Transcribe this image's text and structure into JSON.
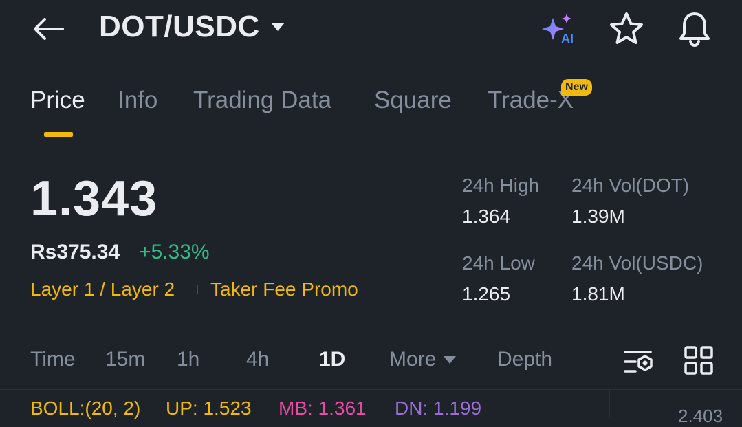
{
  "header": {
    "back_icon": "arrow-left-icon",
    "pair": "DOT/USDC",
    "ai_label": "AI",
    "colors": {
      "ai_gradient_start": "#4c8bf5",
      "ai_gradient_end": "#c87bff"
    }
  },
  "tabs": [
    {
      "label": "Price",
      "active": true
    },
    {
      "label": "Info"
    },
    {
      "label": "Trading Data"
    },
    {
      "label": "Square"
    },
    {
      "label": "Trade-X",
      "badge": "New"
    }
  ],
  "price": {
    "last": "1.343",
    "fiat": "Rs375.34",
    "change": "+5.33%",
    "tags": [
      "Layer 1 / Layer 2",
      "Taker Fee Promo"
    ]
  },
  "stats": {
    "high_label": "24h High",
    "high_value": "1.364",
    "vol_base_label": "24h Vol(DOT)",
    "vol_base_value": "1.39M",
    "low_label": "24h Low",
    "low_value": "1.265",
    "vol_quote_label": "24h Vol(USDC)",
    "vol_quote_value": "1.81M"
  },
  "intervals": {
    "time": "Time",
    "m15": "15m",
    "h1": "1h",
    "h4": "4h",
    "d1": "1D",
    "more": "More",
    "depth": "Depth",
    "active": "1D"
  },
  "indicator": {
    "boll": "BOLL:(20, 2)",
    "up": "UP: 1.523",
    "mb": "MB: 1.361",
    "dn": "DN: 1.199",
    "right_value": "2.403",
    "colors": {
      "boll": "#f0b90b",
      "up": "#f0b90b",
      "mb": "#e84aa4",
      "dn": "#9a6dd7"
    }
  },
  "colors": {
    "background": "#1e2329",
    "accent": "#f0b90b",
    "positive": "#2ebd85",
    "muted": "#848e9c",
    "text": "#eaecef"
  }
}
